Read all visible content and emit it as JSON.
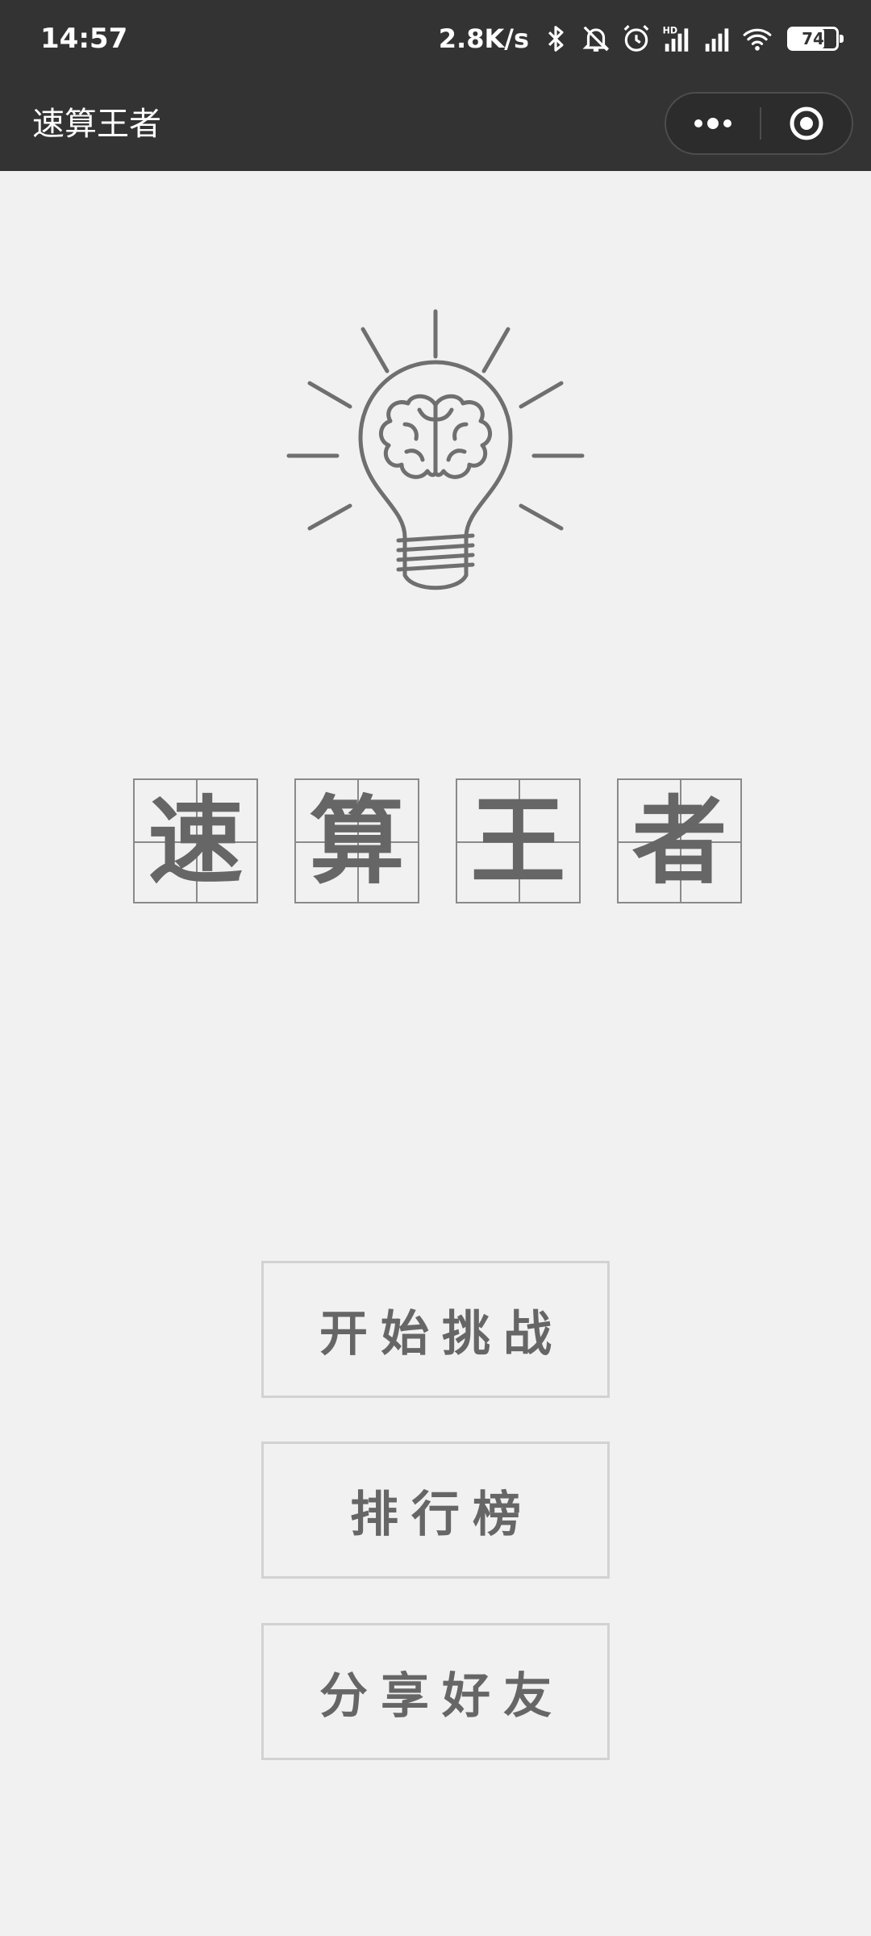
{
  "status_bar": {
    "time": "14:57",
    "net_speed": "2.8K/s",
    "battery_percent": 74,
    "icons": [
      "bluetooth-icon",
      "mute-bell-icon",
      "alarm-icon",
      "hd-signal-icon",
      "signal-icon",
      "wifi-icon",
      "battery-icon"
    ]
  },
  "nav": {
    "title": "速算王者",
    "more_icon": "more-dots-icon",
    "close_icon": "target-circle-icon"
  },
  "logo": {
    "icon": "lightbulb-brain-icon"
  },
  "title_chars": [
    "速",
    "算",
    "王",
    "者"
  ],
  "menu": {
    "start_label": "开始挑战",
    "ranking_label": "排行榜",
    "share_label": "分享好友"
  },
  "colors": {
    "bar_background": "#333333",
    "page_background": "#f1f1f1",
    "text_gray": "#666666",
    "button_border": "#d2d2d2"
  }
}
